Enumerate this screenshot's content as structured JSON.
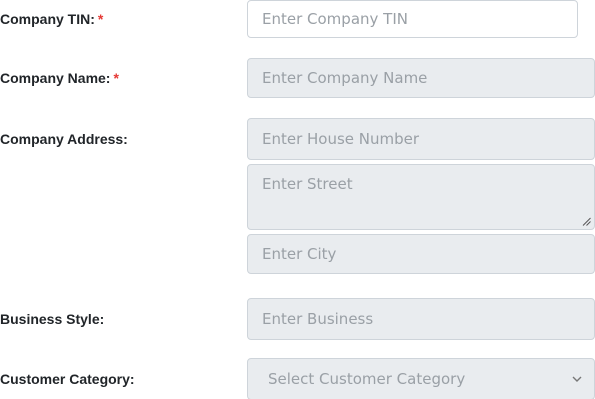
{
  "form": {
    "tin": {
      "label": "Company TIN:",
      "required_mark": "*",
      "placeholder": "Enter Company TIN"
    },
    "name": {
      "label": "Company Name:",
      "required_mark": "*",
      "placeholder": "Enter Company Name"
    },
    "address": {
      "label": "Company Address:",
      "house_placeholder": "Enter House Number",
      "street_placeholder": "Enter Street",
      "city_placeholder": "Enter City"
    },
    "business_style": {
      "label": "Business Style:",
      "placeholder": "Enter Business"
    },
    "customer_category": {
      "label": "Customer Category:",
      "selected": "Select Customer Category",
      "icon": "chevron-down-icon"
    }
  },
  "colors": {
    "required": "#e53935",
    "disabled_bg": "#e9ecef",
    "border": "#ced4da",
    "placeholder": "#9aa0a6",
    "label": "#212529"
  }
}
